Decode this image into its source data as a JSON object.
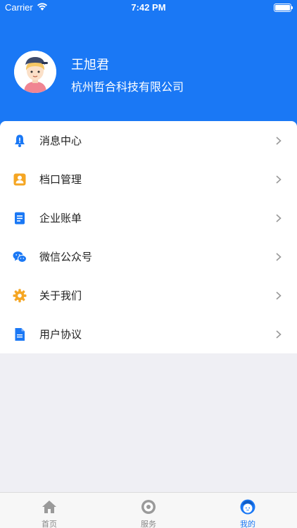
{
  "status_bar": {
    "carrier": "Carrier",
    "time": "7:42 PM"
  },
  "profile": {
    "name": "王旭君",
    "company": "杭州哲合科技有限公司"
  },
  "menu": {
    "items": [
      {
        "label": "消息中心",
        "icon": "bell-icon"
      },
      {
        "label": "档口管理",
        "icon": "person-card-icon"
      },
      {
        "label": "企业账单",
        "icon": "document-icon"
      },
      {
        "label": "微信公众号",
        "icon": "wechat-icon"
      },
      {
        "label": "关于我们",
        "icon": "gear-icon"
      },
      {
        "label": "用户协议",
        "icon": "file-icon"
      }
    ]
  },
  "tabbar": {
    "tabs": [
      {
        "label": "首页",
        "icon": "home-icon",
        "active": false
      },
      {
        "label": "服务",
        "icon": "service-icon",
        "active": false
      },
      {
        "label": "我的",
        "icon": "profile-face-icon",
        "active": true
      }
    ]
  },
  "colors": {
    "accent": "#1a78f5",
    "background": "#efeff4"
  }
}
